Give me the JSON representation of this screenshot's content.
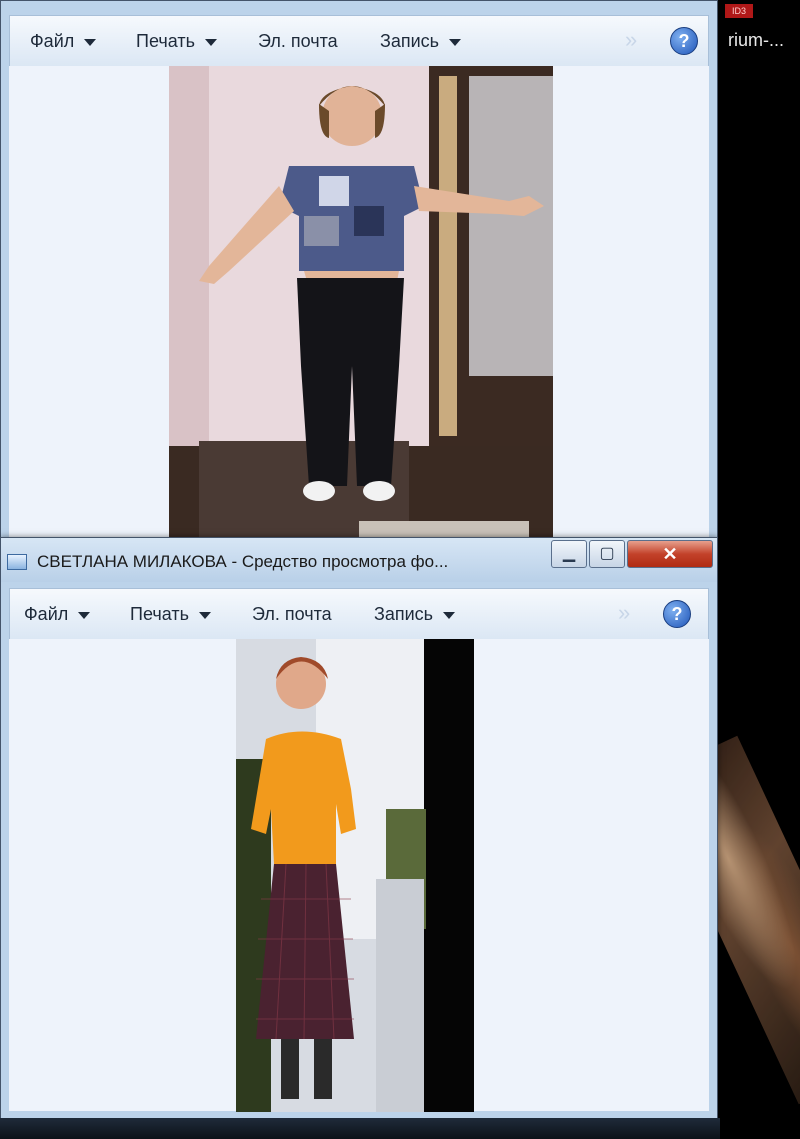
{
  "background": {
    "right_text": "rium-...",
    "badge_text": "ID3"
  },
  "window1": {
    "toolbar": {
      "file": "Файл",
      "print": "Печать",
      "email": "Эл. почта",
      "burn": "Запись",
      "help": "?"
    },
    "photo": {
      "description_icon": "photo-woman-arms-outstretched"
    }
  },
  "window2": {
    "title": "СВЕТЛАНА МИЛАКОВА - Средство просмотра фо...",
    "buttons": {
      "minimize": "▁",
      "maximize": "▢",
      "close": "✕"
    },
    "toolbar": {
      "file": "Файл",
      "print": "Печать",
      "email": "Эл. почта",
      "burn": "Запись",
      "help": "?"
    },
    "photo": {
      "description_icon": "photo-woman-orange-sweater"
    }
  },
  "colors": {
    "toolbar_text": "#1e2a3a",
    "viewer_bg": "#eef3fb",
    "close_red": "#c3422a"
  }
}
